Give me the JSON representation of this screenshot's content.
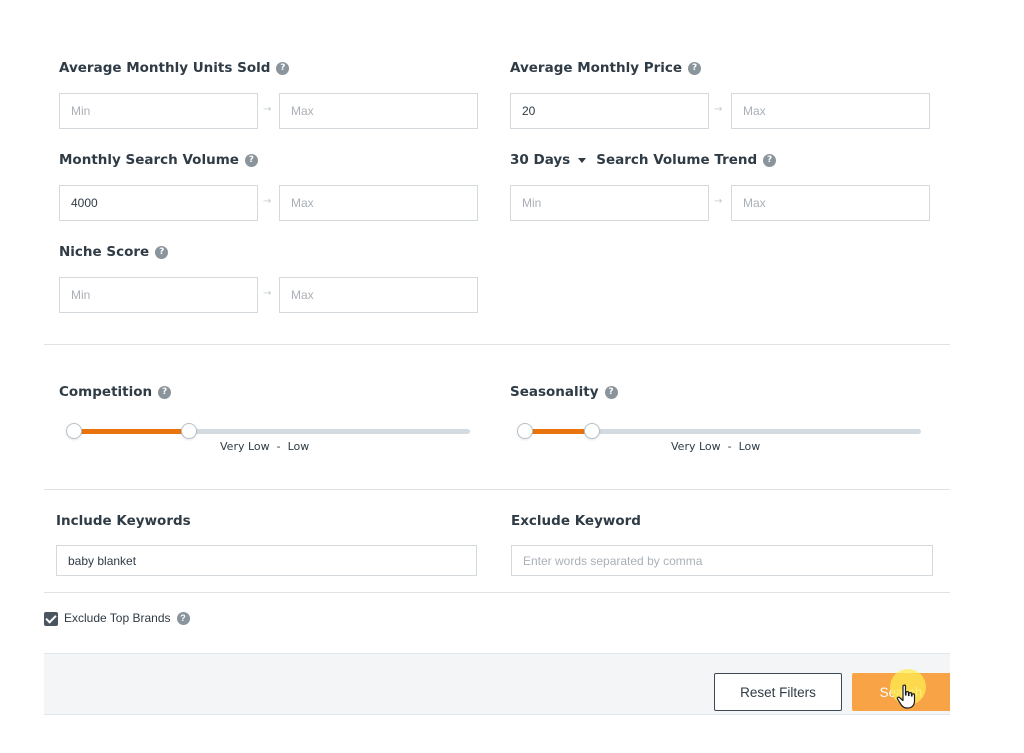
{
  "filters": {
    "avg_units": {
      "label": "Average Monthly Units Sold",
      "min_value": "",
      "max_value": "",
      "min_placeholder": "Min",
      "max_placeholder": "Max"
    },
    "avg_price": {
      "label": "Average Monthly Price",
      "min_value": "20",
      "max_value": "",
      "min_placeholder": "Min",
      "max_placeholder": "Max"
    },
    "search_volume": {
      "label": "Monthly Search Volume",
      "min_value": "4000",
      "max_value": "",
      "min_placeholder": "Min",
      "max_placeholder": "Max"
    },
    "volume_trend": {
      "period": "30 Days",
      "label": "Search Volume Trend",
      "min_value": "",
      "max_value": "",
      "min_placeholder": "Min",
      "max_placeholder": "Max"
    },
    "niche_score": {
      "label": "Niche Score",
      "min_value": "",
      "max_value": "",
      "min_placeholder": "Min",
      "max_placeholder": "Max"
    }
  },
  "sliders": {
    "competition": {
      "label": "Competition",
      "value_text": "Very Low  -  Low",
      "range_fraction": [
        0,
        0.29
      ]
    },
    "seasonality": {
      "label": "Seasonality",
      "value_text": "Very Low  -  Low",
      "range_fraction": [
        0,
        0.17
      ]
    }
  },
  "keywords": {
    "include": {
      "label": "Include Keywords",
      "value": "baby blanket",
      "placeholder": ""
    },
    "exclude": {
      "label": "Exclude Keyword",
      "value": "",
      "placeholder": "Enter words separated by comma"
    }
  },
  "exclude_brands": {
    "label": "Exclude Top Brands",
    "checked": true
  },
  "buttons": {
    "reset": "Reset Filters",
    "search": "Search"
  },
  "colors": {
    "accent_orange": "#e9730c",
    "search_button": "#f7a346",
    "track": "#d3dbe1"
  },
  "icons": {
    "help": "?",
    "arrow": "→"
  }
}
